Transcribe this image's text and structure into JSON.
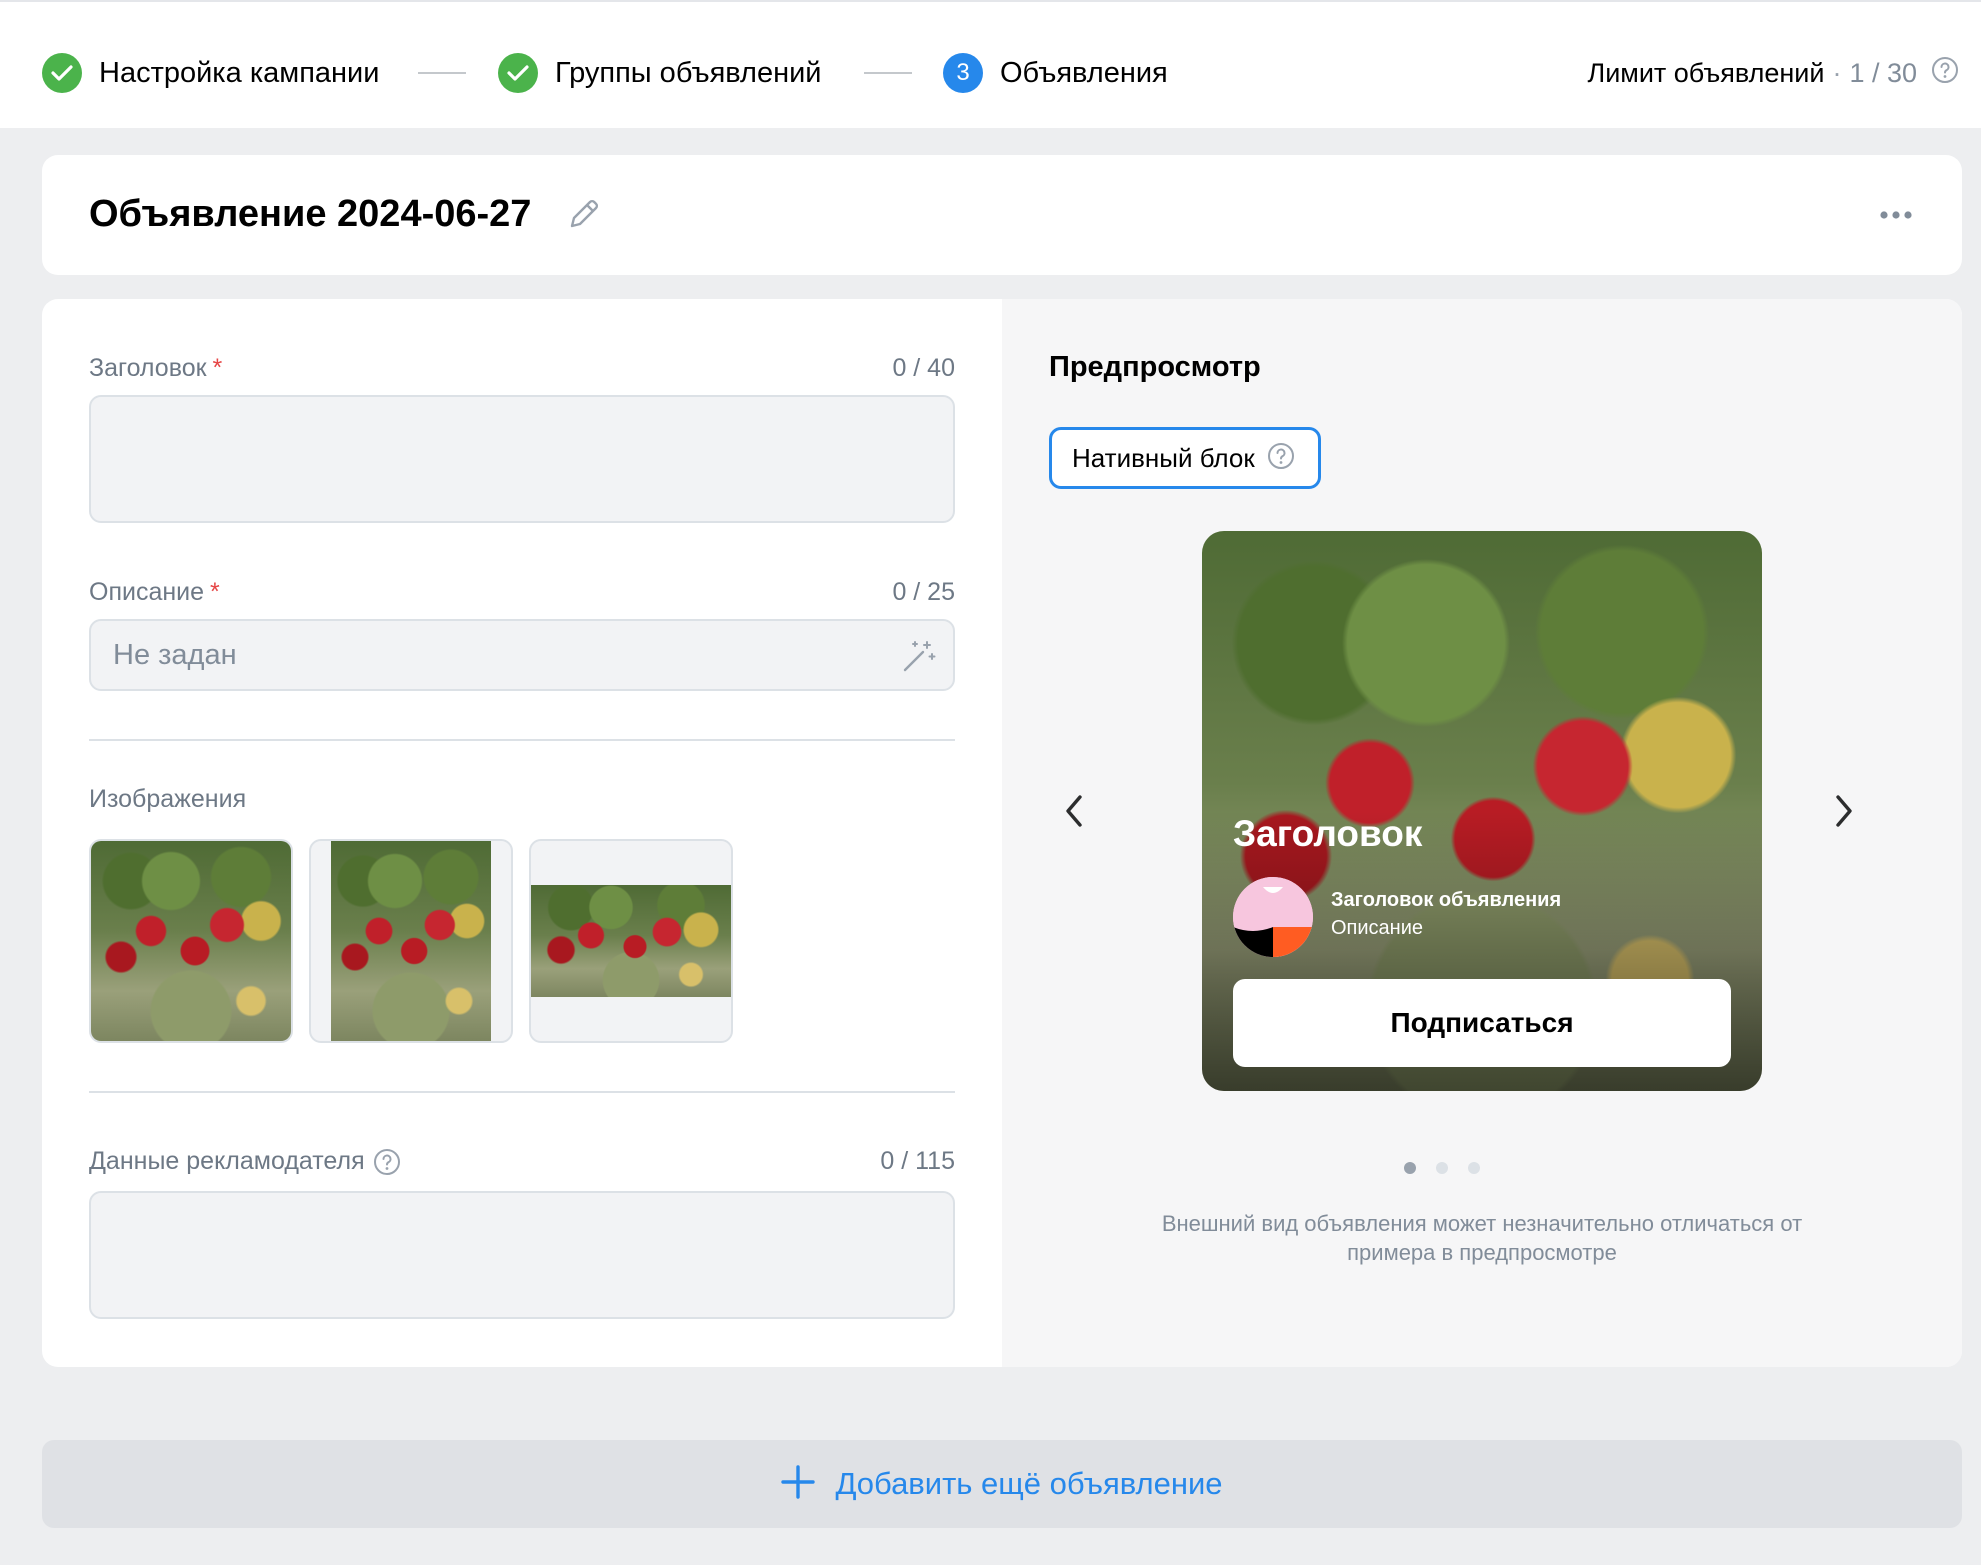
{
  "stepper": {
    "steps": [
      {
        "label": "Настройка кампании",
        "state": "done"
      },
      {
        "label": "Группы объявлений",
        "state": "done"
      },
      {
        "label": "Объявления",
        "state": "active",
        "number": "3"
      }
    ],
    "limit": {
      "label": "Лимит объявлений",
      "separator": "·",
      "value": "1 / 30"
    }
  },
  "ad": {
    "title": "Объявление 2024-06-27"
  },
  "form": {
    "headline": {
      "label": "Заголовок",
      "required_mark": "*",
      "counter": "0 / 40",
      "value": ""
    },
    "description": {
      "label": "Описание",
      "required_mark": "*",
      "counter": "0 / 25",
      "value": "Не задан"
    },
    "images": {
      "label": "Изображения"
    },
    "advertiser": {
      "label": "Данные рекламодателя",
      "counter": "0 / 115",
      "value": ""
    }
  },
  "preview": {
    "title": "Предпросмотр",
    "format_chip": "Нативный блок",
    "card": {
      "headline": "Заголовок",
      "ad_title": "Заголовок объявления",
      "ad_description": "Описание",
      "button": "Подписаться"
    },
    "pager": {
      "count": 3,
      "active": 0
    },
    "note": "Внешний вид объявления может незначительно отличаться от примера в предпросмотре"
  },
  "add_button": "Добавить ещё объявление",
  "colors": {
    "accent": "#2688eb",
    "success": "#4bb34b",
    "required": "#e64646"
  }
}
